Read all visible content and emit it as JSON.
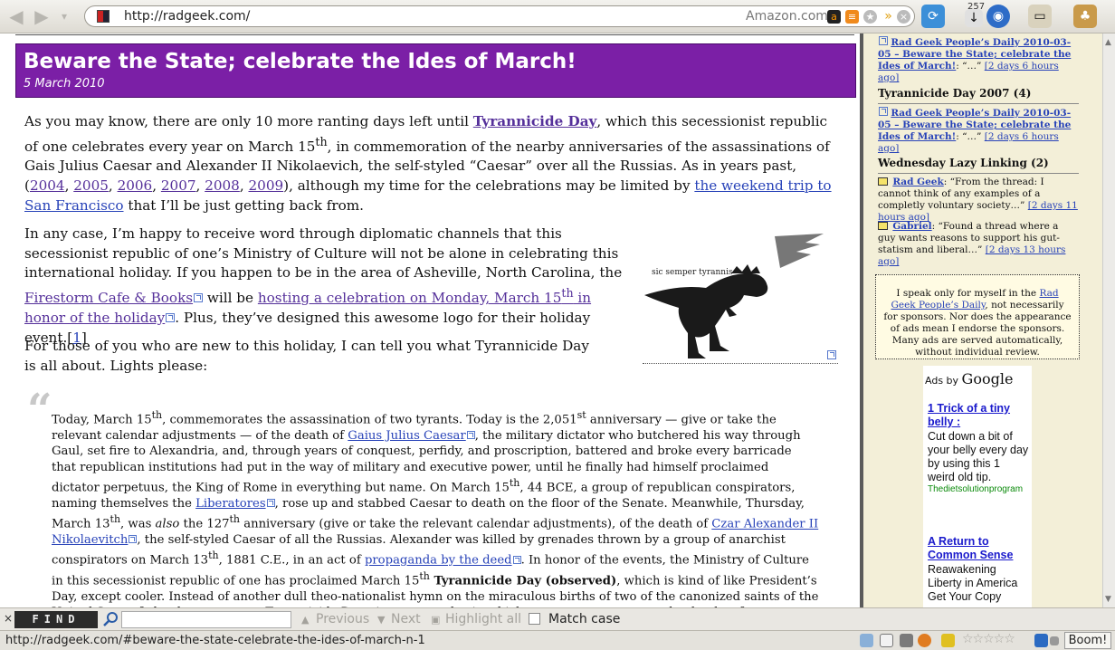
{
  "browser": {
    "url": "http://radgeek.com/",
    "search_engine": "Amazon.com",
    "download_count": "257"
  },
  "post": {
    "title": "Beware the State; celebrate the Ides of March!",
    "date": "5 March 2010",
    "p1": {
      "t1": "As you may know, there are only 10 more ranting days left until ",
      "link_tyrannicide": "Tyrannicide Day",
      "t2": ", which this secessionist republic of one celebrates every year on March 15",
      "sup": "th",
      "t3": ", in commemoration of the nearby anniversaries of the assassinations of Gais Julius Caesar and Alexander II Nikolaevich, the self-styled “Caesar” over all the Russias. As in years past, (",
      "years": [
        "2004",
        "2005",
        "2006",
        "2007",
        "2008",
        "2009"
      ],
      "t4": "), although my time for the celebrations may be limited by ",
      "link_trip": "the weekend trip to San Francisco",
      "t5": " that I’ll be just getting back from."
    },
    "p2": {
      "t1": "In any case, I’m happy to receive word through diplomatic channels that this secessionist republic of one’s Ministry of Culture will not be alone in celebrating this international holiday. If you happen to be in the area of Asheville, North Carolina, the ",
      "link_firestorm": "Firestorm Cafe & Books",
      "t2": " will be ",
      "link_hosting": "hosting a celebration on Monday, March 15",
      "sup": "th",
      "link_hosting2": " in honor of the holiday",
      "t3": ". Plus, they’ve designed this awesome logo for their holiday event.[",
      "footnote": "1",
      "t4": "]"
    },
    "p3": "For those of you who are new to this holiday, I can tell you what Tyrannicide Day is all about. Lights please:",
    "logo_caption": "sic semper tyrannis",
    "quote": {
      "a1": "Today, March 15",
      "a1sup": "th",
      "a2": ", commemorates the assassination of two tyrants. Today is the 2,051",
      "a2sup": "st",
      "a3": " anniversary — give or take the relevant calendar adjustments — of the death of ",
      "link_caesar": "Gaius Julius Caesar",
      "a4": ", the military dictator who butchered his way through Gaul, set fire to Alexandria, and, through years of conquest, perfidy, and proscription, battered and broke every barricade that republican institutions had put in the way of military and executive power, until he finally had himself proclaimed dictator perpetuus, the King of Rome in everything but name. On March 15",
      "a4sup": "th",
      "a5": ", 44 BCE, a group of republican conspirators, naming themselves the ",
      "link_liberatores": "Liberatores",
      "a6": ", rose up and stabbed Caesar to death on the floor of the Senate. Meanwhile, Thursday, March 13",
      "a6sup": "th",
      "a7": ", was ",
      "a7em": "also",
      "a8": " the 127",
      "a8sup": "th",
      "a9": " anniversary (give or take the relevant calendar adjustments), of the death of ",
      "link_czar": "Czar Alexander II Nikolaevitch",
      "a10": ", the self-styled Caesar of all the Russias. Alexander was killed by grenades thrown by a group of anarchist conspirators on March 13",
      "a10sup": "th",
      "a11": ", 1881 C.E., in an act of ",
      "link_propaganda": "propaganda by the deed",
      "a12": ". In honor of the events, the Ministry of Culture in this secessionist republic of one has proclaimed March 15",
      "a12sup": "th",
      "a13bold": " Tyrannicide Day (observed)",
      "a14": ", which is kind of like President’s Day, except cooler. Instead of another dull theo-nationalist hymn on the miraculous births of two of the canonized saints of the United States federal government, Tyrannicide Day gives us one day in which we can commemorate the deaths of two tyrants at the hands of their equals — men and women who defied the tyrants’ arbitrary claims to an unchecked authority that they had neither the wisdom, the virtue, nor the right to exercise. Men and women who saw themselves as"
    }
  },
  "sidebar": {
    "entry1": {
      "link": "Rad Geek People’s Daily 2010-03-05 – Beware the State; celebrate the Ides of March!",
      "excerpt": ": “…” ",
      "time": "[2 days 6 hours ago]"
    },
    "head2": "Tyrannicide Day 2007 ",
    "head2_count": "(4)",
    "entry2": {
      "link": "Rad Geek People’s Daily 2010-03-05 – Beware the State; celebrate the Ides of March!",
      "excerpt": ": “…” ",
      "time": "[2 days 6 hours ago]"
    },
    "head3": "Wednesday Lazy Linking ",
    "head3_count": "(2)",
    "entry3": {
      "author": "Rad Geek",
      "excerpt": ": “From the thread: I cannot think of any examples of a completly voluntary society…” ",
      "time": "[2 days 11 hours ago]"
    },
    "entry4": {
      "author": "Gabriel",
      "excerpt": ": “Found a thread where a guy wants reasons to support his gut-statism and liberal…” ",
      "time": "[2 days 13 hours ago]"
    },
    "disclaimer": {
      "t1": "I speak only for myself in the ",
      "link": "Rad Geek People’s Daily",
      "t2": ", not necessarily for sponsors. Nor does the appearance of ads mean I endorse the sponsors. Many ads are served automatically, without individual review."
    },
    "ads": {
      "label": "Ads by ",
      "google": "Google",
      "ad1": {
        "title": "1 Trick of a tiny belly :",
        "body": "Cut down a bit of your belly every day by using this 1 weird old tip.",
        "url": "Thedietsolutionprogram"
      },
      "ad2": {
        "title": "A Return to Common Sense",
        "body": "Reawakening Liberty in America Get Your Copy"
      }
    }
  },
  "findbar": {
    "close": "×",
    "label": "FIND",
    "previous": "Previous",
    "next": "Next",
    "highlight": "Highlight all",
    "match_case": "Match case"
  },
  "status": {
    "url": "http://radgeek.com/#beware-the-state-celebrate-the-ides-of-march-n-1",
    "rating_stars": "☆☆☆☆☆",
    "boom": "Boom!"
  },
  "colors": {
    "banner": "#7b1fa6",
    "sidebar_bg": "#f3efd8",
    "link": "#55309a"
  }
}
